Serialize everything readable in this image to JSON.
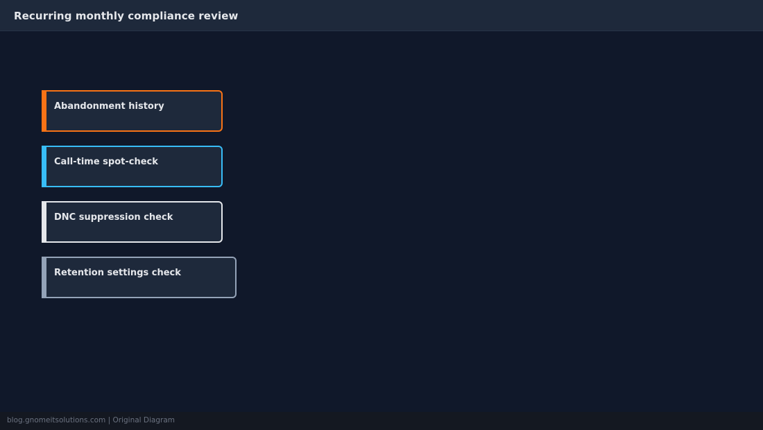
{
  "header": {
    "title": "Recurring monthly compliance review"
  },
  "diagram": {
    "nodes": [
      {
        "label": "Abandonment history",
        "accent": "#f97316"
      },
      {
        "label": "Call-time spot-check",
        "accent": "#38bdf8"
      },
      {
        "label": "DNC suppression check",
        "accent": "#e5e7eb"
      },
      {
        "label": "Retention settings check",
        "accent": "#94a3b8"
      }
    ]
  },
  "footer": {
    "text": "blog.gnomeitsolutions.com | Original Diagram"
  }
}
